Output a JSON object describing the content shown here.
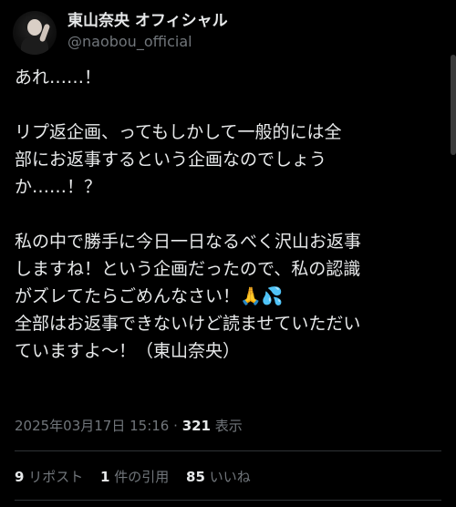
{
  "author": {
    "display_name": "東山奈央 オフィシャル",
    "handle": "@naobou_official"
  },
  "tweet": {
    "lines": [
      "あれ……！",
      "",
      "リプ返企画、ってもしかして一般的には全",
      "部にお返事するという企画なのでしょう",
      "か……！？",
      "",
      "私の中で勝手に今日一日なるべく沢山お返事",
      "しますね！という企画だったので、私の認識",
      "がズレてたらごめんなさい！🙏💦",
      "全部はお返事できないけど読ませていただい",
      "ていますよ〜！（東山奈央）"
    ]
  },
  "meta": {
    "timestamp": "2025年03月17日 15:16",
    "separator": "·",
    "views_count": "321",
    "views_label": "表示"
  },
  "stats": {
    "retweets_count": "9",
    "retweets_label": "リポスト",
    "quotes_count": "1",
    "quotes_label": "件の引用",
    "likes_count": "85",
    "likes_label": "いいね"
  },
  "icons": {
    "more": "more-icon"
  }
}
